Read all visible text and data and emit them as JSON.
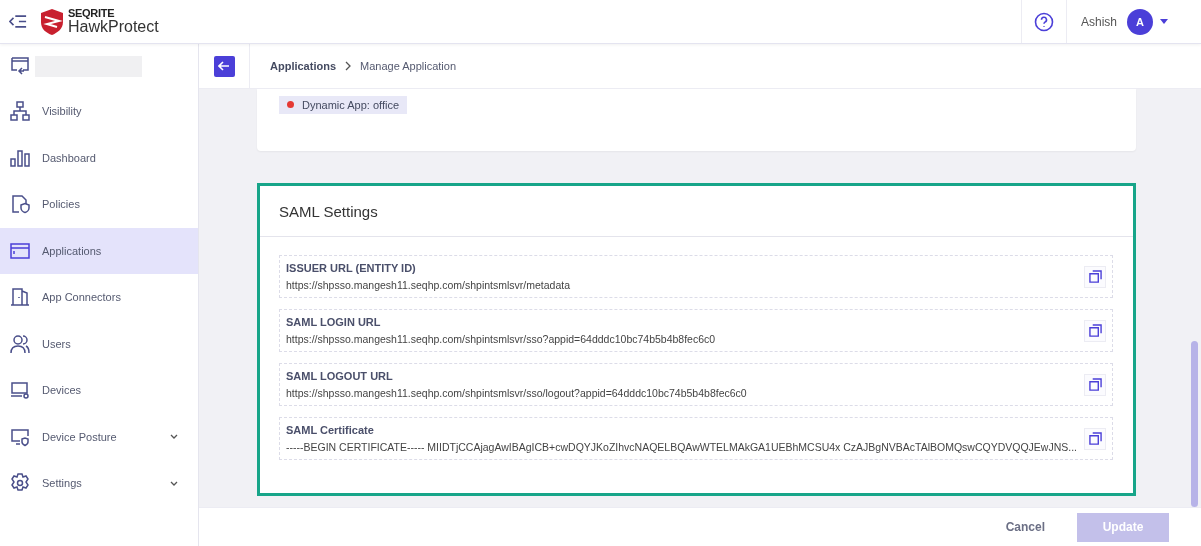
{
  "header": {
    "brand_top": "SEQRITE",
    "brand_bottom": "HawkProtect",
    "user": "Ashish",
    "avatar": "A"
  },
  "sidebar": {
    "items": [
      {
        "label": "Visibility",
        "selected": false,
        "expandable": false
      },
      {
        "label": "Dashboard",
        "selected": false,
        "expandable": false
      },
      {
        "label": "Policies",
        "selected": false,
        "expandable": false
      },
      {
        "label": "Applications",
        "selected": true,
        "expandable": false
      },
      {
        "label": "App Connectors",
        "selected": false,
        "expandable": false
      },
      {
        "label": "Users",
        "selected": false,
        "expandable": false
      },
      {
        "label": "Devices",
        "selected": false,
        "expandable": false
      },
      {
        "label": "Device Posture",
        "selected": false,
        "expandable": true
      },
      {
        "label": "Settings",
        "selected": false,
        "expandable": true
      }
    ]
  },
  "breadcrumb": [
    "Applications",
    "Manage Application"
  ],
  "tag": {
    "label": "Dynamic App: office",
    "color": "#e53935"
  },
  "saml": {
    "title": "SAML Settings",
    "fields": [
      {
        "label": "ISSUER URL (ENTITY ID)",
        "value": "https://shpsso.mangesh11.seqhp.com/shpintsmlsvr/metadata"
      },
      {
        "label": "SAML LOGIN URL",
        "value": "https://shpsso.mangesh11.seqhp.com/shpintsmlsvr/sso?appid=64dddc10bc74b5b4b8fec6c0"
      },
      {
        "label": "SAML LOGOUT URL",
        "value": "https://shpsso.mangesh11.seqhp.com/shpintsmlsvr/sso/logout?appid=64dddc10bc74b5b4b8fec6c0"
      },
      {
        "label": "SAML Certificate",
        "value": "-----BEGIN CERTIFICATE----- MIIDTjCCAjagAwIBAgICB+cwDQYJKoZIhvcNAQELBQAwWTELMAkGA1UEBhMCSU4x CzAJBgNVBAcTAlBOMQswCQYDVQQJEwJNS..."
      }
    ]
  },
  "footer": {
    "cancel": "Cancel",
    "update": {
      "label": "Update",
      "disabled": true
    }
  }
}
